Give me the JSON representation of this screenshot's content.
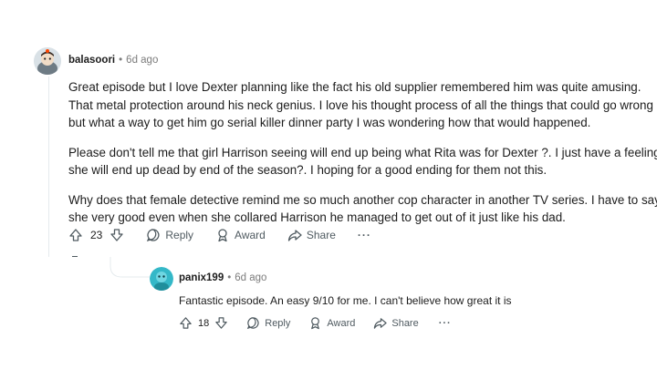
{
  "comments": [
    {
      "username": "balasoori",
      "separator": "•",
      "time": "6d ago",
      "paragraphs": [
        "Great episode but I love Dexter planning like the fact his old supplier remembered him was quite amusing.",
        "That metal protection around his neck genius. I love his thought process of all the things that could go wrong",
        "but what a way to get him go serial killer dinner party I was wondering how that would happened.",
        "Please don't tell me that girl Harrison seeing will end up being what Rita was for Dexter ?. I just have a feeling",
        "she will end up dead by end of the season?. I hoping for a good ending for them not this.",
        "Why does that female detective remind me so much another cop character in another TV series. I have to say",
        "she very good even when she collared Harrison he managed to get out of it just like his dad."
      ],
      "votes": "23",
      "actions": {
        "reply": "Reply",
        "award": "Award",
        "share": "Share",
        "more": "···"
      }
    },
    {
      "username": "panix199",
      "separator": "•",
      "time": "6d ago",
      "paragraphs": [
        "Fantastic episode. An easy 9/10 for me. I can't believe how great it is"
      ],
      "votes": "18",
      "actions": {
        "reply": "Reply",
        "award": "Award",
        "share": "Share",
        "more": "···"
      }
    }
  ],
  "colors": {
    "accent_avatar2": "#34b8c8",
    "thread_line": "#e5ebee",
    "meta_gray": "#7c7c7c"
  }
}
